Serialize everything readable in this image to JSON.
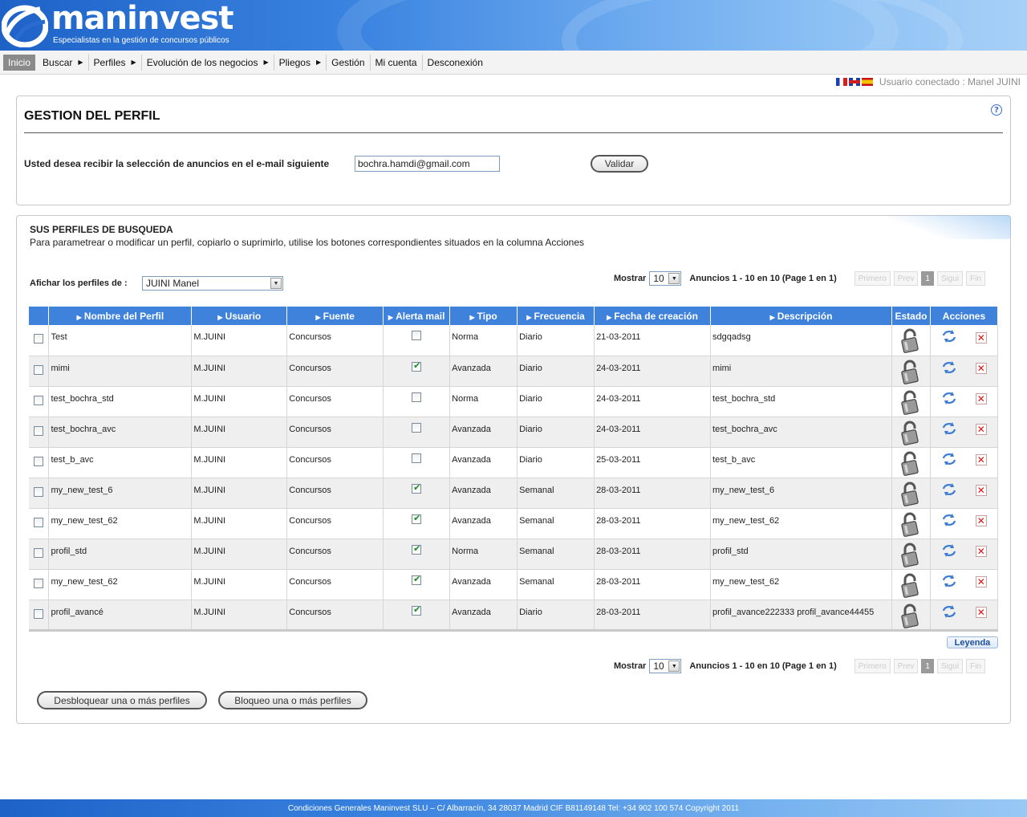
{
  "brand": {
    "name": "maninvest",
    "tagline": "Especialistas en la gestión de concursos públicos"
  },
  "menu": [
    {
      "label": "Inicio",
      "active": true,
      "submenu": false
    },
    {
      "label": "Buscar",
      "active": false,
      "submenu": true
    },
    {
      "label": "Perfiles",
      "active": false,
      "submenu": true
    },
    {
      "label": "Evolución de los negocios",
      "active": false,
      "submenu": true
    },
    {
      "label": "Pliegos",
      "active": false,
      "submenu": true
    },
    {
      "label": "Gestión",
      "active": false,
      "submenu": false
    },
    {
      "label": "Mi cuenta",
      "active": false,
      "submenu": false
    },
    {
      "label": "Desconexión",
      "active": false,
      "submenu": false
    }
  ],
  "userbar": {
    "text": "Usuario conectado : Manel JUINI"
  },
  "gestion": {
    "title": "GESTION DEL PERFIL",
    "email_label": "Usted desea recibir la selección de anuncios en el e-mail siguiente",
    "email_value": "bochra.hamdi@gmail.com",
    "validar_label": "Validar"
  },
  "perfiles": {
    "title": "SUS PERFILES DE BUSQUEDA",
    "description": "Para parametrear o modificar un perfil, copiarlo o suprimirlo, utilise los botones correspondientes situados en la columna Acciones",
    "afichar_label": "Afichar los perfiles de :",
    "afichar_value": "JUINI Manel",
    "pager": {
      "mostrar_label": "Mostrar",
      "mostrar_value": "10",
      "info": "Anuncios 1 - 10 en 10  (Page 1 en 1)",
      "first": "Primero",
      "prev": "Prev",
      "current": "1",
      "next": "Sigui",
      "last": "Fin"
    },
    "columns": {
      "nombre": "Nombre del Perfil",
      "usuario": "Usuario",
      "fuente": "Fuente",
      "alerta": "Alerta mail",
      "tipo": "Tipo",
      "frecuencia": "Frecuencia",
      "fecha": "Fecha de creación",
      "descripcion": "Descripción",
      "estado": "Estado",
      "acciones": "Acciones"
    },
    "rows": [
      {
        "nombre": "Test",
        "usuario": "M.JUINI",
        "fuente": "Concursos",
        "alerta": false,
        "tipo": "Norma",
        "frecuencia": "Diario",
        "fecha": "21-03-2011",
        "descripcion": "sdgqadsg"
      },
      {
        "nombre": "mimi",
        "usuario": "M.JUINI",
        "fuente": "Concursos",
        "alerta": true,
        "tipo": "Avanzada",
        "frecuencia": "Diario",
        "fecha": "24-03-2011",
        "descripcion": "mimi"
      },
      {
        "nombre": "test_bochra_std",
        "usuario": "M.JUINI",
        "fuente": "Concursos",
        "alerta": false,
        "tipo": "Norma",
        "frecuencia": "Diario",
        "fecha": "24-03-2011",
        "descripcion": "test_bochra_std"
      },
      {
        "nombre": "test_bochra_avc",
        "usuario": "M.JUINI",
        "fuente": "Concursos",
        "alerta": false,
        "tipo": "Avanzada",
        "frecuencia": "Diario",
        "fecha": "24-03-2011",
        "descripcion": "test_bochra_avc"
      },
      {
        "nombre": "test_b_avc",
        "usuario": "M.JUINI",
        "fuente": "Concursos",
        "alerta": false,
        "tipo": "Avanzada",
        "frecuencia": "Diario",
        "fecha": "25-03-2011",
        "descripcion": "test_b_avc"
      },
      {
        "nombre": "my_new_test_6",
        "usuario": "M.JUINI",
        "fuente": "Concursos",
        "alerta": true,
        "tipo": "Avanzada",
        "frecuencia": "Semanal",
        "fecha": "28-03-2011",
        "descripcion": "my_new_test_6"
      },
      {
        "nombre": "my_new_test_62",
        "usuario": "M.JUINI",
        "fuente": "Concursos",
        "alerta": true,
        "tipo": "Avanzada",
        "frecuencia": "Semanal",
        "fecha": "28-03-2011",
        "descripcion": "my_new_test_62"
      },
      {
        "nombre": "profil_std",
        "usuario": "M.JUINI",
        "fuente": "Concursos",
        "alerta": true,
        "tipo": "Norma",
        "frecuencia": "Semanal",
        "fecha": "28-03-2011",
        "descripcion": "profil_std"
      },
      {
        "nombre": "my_new_test_62",
        "usuario": "M.JUINI",
        "fuente": "Concursos",
        "alerta": true,
        "tipo": "Avanzada",
        "frecuencia": "Semanal",
        "fecha": "28-03-2011",
        "descripcion": "my_new_test_62"
      },
      {
        "nombre": "profil_avancé",
        "usuario": "M.JUINI",
        "fuente": "Concursos",
        "alerta": true,
        "tipo": "Avanzada",
        "frecuencia": "Diario",
        "fecha": "28-03-2011",
        "descripcion": "profil_avance222333 profil_avance44455"
      }
    ],
    "leyenda_label": "Leyenda",
    "unlock_label": "Desbloquear una o más perfiles",
    "lock_label": "Bloqueo una o más perfiles"
  },
  "footer": {
    "text": "Condiciones Generales Maninvest SLU – C/ Albarracín, 34 28037 Madrid CIF B81149148 Tel: +34 902 100 574 Copyright 2011"
  },
  "icons": {
    "estado": "padlock-icon",
    "copy": "refresh-copy-icon",
    "delete": "delete-x-icon",
    "help": "help-icon"
  },
  "colors": {
    "header_blue": "#1e62c8",
    "table_header": "#3f82dc",
    "delete_red": "#e01010",
    "check_green": "#1b8a2a"
  }
}
